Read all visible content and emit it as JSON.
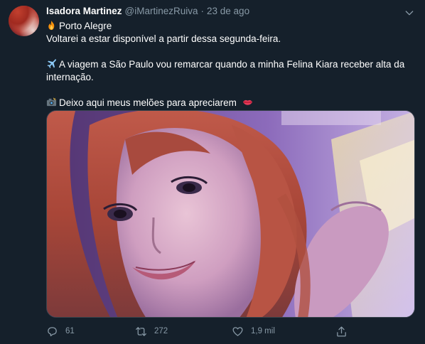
{
  "tweet": {
    "author_name": "Isadora Martinez",
    "author_handle": "@iMartinezRuiva",
    "separator": "·",
    "timestamp": "23 de ago",
    "lines": [
      "Porto Alegre",
      "Voltarei a estar disponível a partir dessa segunda-feira.",
      "A viagem a São Paulo vou remarcar quando a minha Felina Kiara receber alta da",
      "internação.",
      "Deixo aqui meus melões para apreciarem"
    ],
    "icons": {
      "location": "fire-icon",
      "travel": "airplane-icon",
      "photo": "camera-flash-icon",
      "closing": "lips-icon",
      "menu": "chevron-down-icon"
    }
  },
  "actions": {
    "reply_count": "61",
    "retweet_count": "272",
    "like_count": "1,9 mil",
    "reply_icon": "reply-icon",
    "retweet_icon": "retweet-icon",
    "like_icon": "heart-icon",
    "share_icon": "share-icon"
  },
  "colors": {
    "background": "#15202b",
    "secondary_text": "#8899a6",
    "primary_text": "#ffffff",
    "border": "#38444d"
  }
}
